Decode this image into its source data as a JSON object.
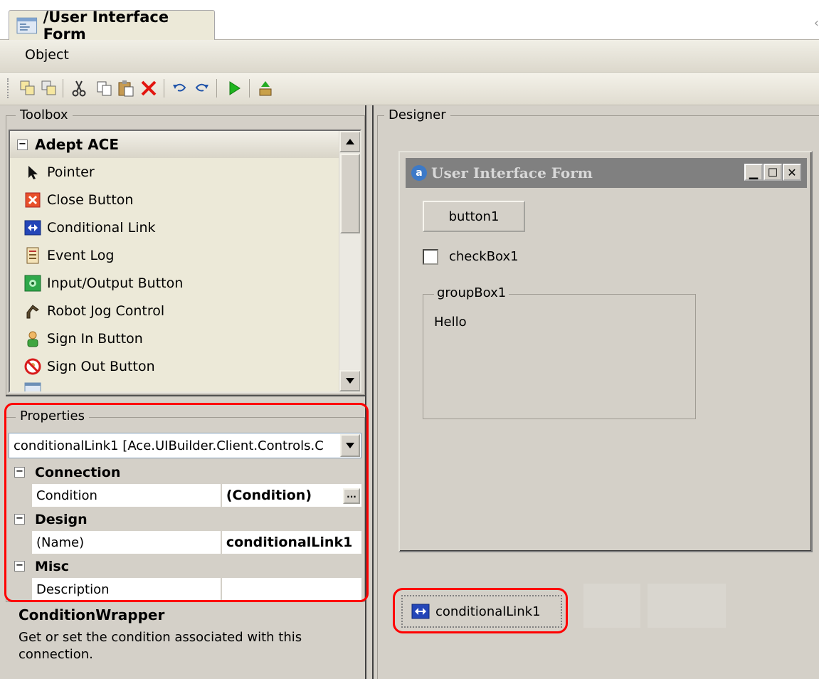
{
  "tab": {
    "title": "/User Interface Form"
  },
  "menu": {
    "items": [
      "Object"
    ]
  },
  "toolbar": {
    "icons": [
      "copy-object-icon",
      "paste-object-icon",
      "cut-icon",
      "copy-icon",
      "paste-icon",
      "delete-icon",
      "undo-icon",
      "redo-icon",
      "run-icon",
      "build-icon"
    ]
  },
  "toolbox": {
    "title": "Toolbox",
    "category": "Adept ACE",
    "items": [
      {
        "label": "Pointer",
        "icon": "pointer-icon"
      },
      {
        "label": "Close Button",
        "icon": "close-button-icon"
      },
      {
        "label": "Conditional Link",
        "icon": "conditional-link-icon"
      },
      {
        "label": "Event Log",
        "icon": "event-log-icon"
      },
      {
        "label": "Input/Output Button",
        "icon": "io-button-icon"
      },
      {
        "label": "Robot Jog Control",
        "icon": "robot-jog-icon"
      },
      {
        "label": "Sign In Button",
        "icon": "sign-in-icon"
      },
      {
        "label": "Sign Out Button",
        "icon": "sign-out-icon"
      }
    ]
  },
  "properties": {
    "title": "Properties",
    "selected_object": "conditionalLink1 [Ace.UIBuilder.Client.Controls.C",
    "categories": [
      {
        "name": "Connection",
        "props": [
          {
            "name": "Condition",
            "value": "(Condition)"
          }
        ]
      },
      {
        "name": "Design",
        "props": [
          {
            "name": "(Name)",
            "value": "conditionalLink1"
          }
        ]
      },
      {
        "name": "Misc",
        "props": [
          {
            "name": "Description",
            "value": ""
          }
        ]
      }
    ],
    "description_title": "ConditionWrapper",
    "description_text": "Get or set the condition associated with this connection."
  },
  "designer": {
    "title": "Designer",
    "form_title": "User Interface Form",
    "button_label": "button1",
    "checkbox_label": "checkBox1",
    "groupbox_label": "groupBox1",
    "groupbox_text": "Hello",
    "component_label": "conditionalLink1"
  },
  "colors": {
    "highlight": "#ff0000",
    "background": "#d4d0c8",
    "titlebar_inactive": "#808080"
  }
}
